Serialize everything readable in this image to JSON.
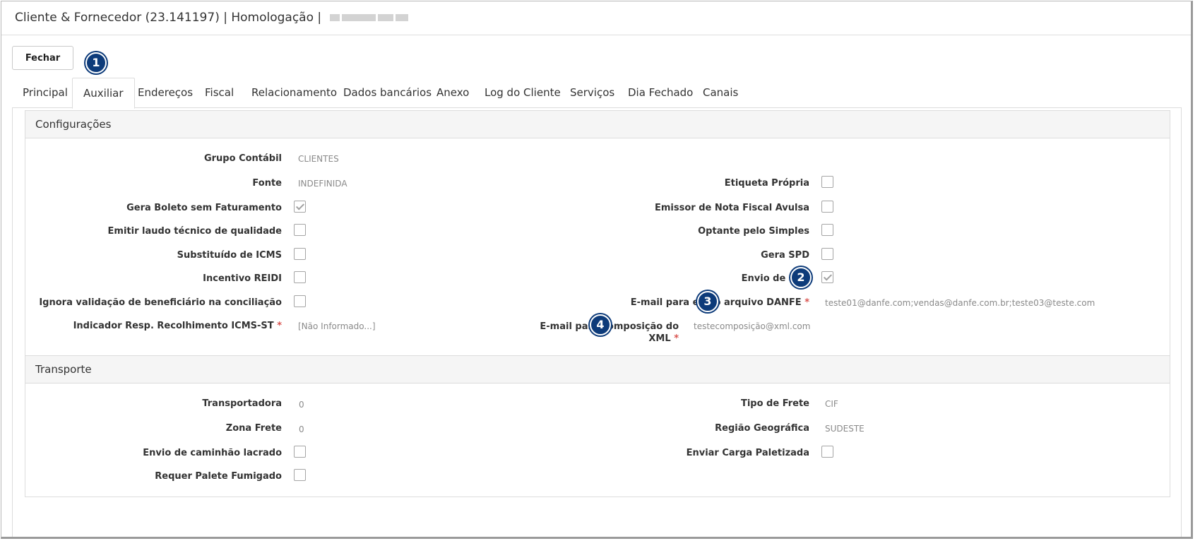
{
  "window": {
    "title": "Cliente & Fornecedor (23.141197) | Homologação |"
  },
  "toolbar": {
    "close_label": "Fechar"
  },
  "tabs": [
    "Principal",
    "Auxiliar",
    "Endereços",
    "Fiscal",
    "Relacionamento",
    "Dados bancários",
    "Anexo",
    "Log do Cliente",
    "Serviços",
    "Dia Fechado",
    "Canais"
  ],
  "active_tab": "Auxiliar",
  "badges": [
    "1",
    "2",
    "3",
    "4"
  ],
  "config": {
    "title": "Configurações",
    "grupo_contabil": {
      "label": "Grupo Contábil",
      "value": "CLIENTES"
    },
    "fonte": {
      "label": "Fonte",
      "value": "INDEFINIDA"
    },
    "gera_boleto": {
      "label": "Gera Boleto sem Faturamento",
      "checked": true
    },
    "emitir_laudo": {
      "label": "Emitir laudo técnico de qualidade",
      "checked": false
    },
    "substituido_icms": {
      "label": "Substituído de ICMS",
      "checked": false
    },
    "incentivo_reidi": {
      "label": "Incentivo REIDI",
      "checked": false
    },
    "ignora_validacao": {
      "label": "Ignora validação de beneficiário na conciliação",
      "checked": false
    },
    "indicador_resp": {
      "label": "Indicador Resp. Recolhimento ICMS-ST",
      "value": "[Não Informado...]"
    },
    "etiqueta_propria": {
      "label": "Etiqueta Própria",
      "checked": false
    },
    "emissor_nf_avulsa": {
      "label": "Emissor de Nota Fiscal Avulsa",
      "checked": false
    },
    "optante_simples": {
      "label": "Optante pelo Simples",
      "checked": false
    },
    "gera_spd": {
      "label": "Gera SPD",
      "checked": false
    },
    "envio_pdf": {
      "label": "Envio de PDF",
      "checked": true
    },
    "email_danfe": {
      "label": "E-mail para envio arquivo DANFE",
      "value": "teste01@danfe.com;vendas@danfe.com.br;teste03@teste.com"
    },
    "email_xml": {
      "label_line1": "E-mail para composição do",
      "label_line2": "XML",
      "value": "testecomposição@xml.com"
    },
    "required_mark": "*"
  },
  "transport": {
    "title": "Transporte",
    "transportadora": {
      "label": "Transportadora",
      "value": "0"
    },
    "zona_frete": {
      "label": "Zona Frete",
      "value": "0"
    },
    "envio_caminhao": {
      "label": "Envio de caminhão lacrado",
      "checked": false
    },
    "requer_palete": {
      "label": "Requer Palete Fumigado",
      "checked": false
    },
    "tipo_frete": {
      "label": "Tipo de Frete",
      "value": "CIF"
    },
    "regiao_geografica": {
      "label": "Região Geográfica",
      "value": "SUDESTE"
    },
    "enviar_carga": {
      "label": "Enviar Carga Paletizada",
      "checked": false
    }
  },
  "colors": {
    "badge": "#0d3b7a",
    "required": "#d9534f",
    "section_header": "#f5f5f5"
  }
}
